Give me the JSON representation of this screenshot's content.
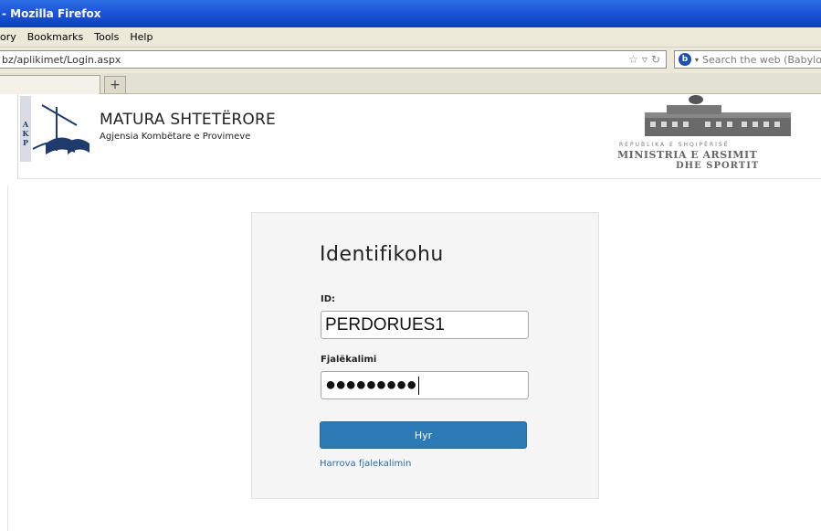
{
  "window": {
    "title": "- Mozilla Firefox"
  },
  "menu": {
    "items": [
      "ory",
      "Bookmarks",
      "Tools",
      "Help"
    ]
  },
  "address": {
    "url": "bz/aplikimet/Login.aspx"
  },
  "search": {
    "placeholder": "Search the web (Babylo"
  },
  "tabs": {
    "new_tab_label": "+"
  },
  "header": {
    "title": "MATURA SHTETËRORE",
    "subtitle": "Agjensia Kombëtare e Provimeve",
    "logo_letters": [
      "A",
      "K",
      "P"
    ],
    "ministry_line_small": "REPUBLIKA E SHQIPËRISË",
    "ministry_line1": "MINISTRIA E ARSIMIT",
    "ministry_line2": "DHE SPORTIT"
  },
  "login": {
    "heading": "Identifikohu",
    "id_label": "ID:",
    "id_value": "PERDORUES1",
    "password_label": "Fjalëkalimi",
    "password_value": "●●●●●●●●●",
    "submit_label": "Hyr",
    "forgot_label": "Harrova fjalekalimin"
  },
  "colors": {
    "titlebar": "#1d55d8",
    "button": "#2c7bb6",
    "link": "#2a6da8"
  }
}
